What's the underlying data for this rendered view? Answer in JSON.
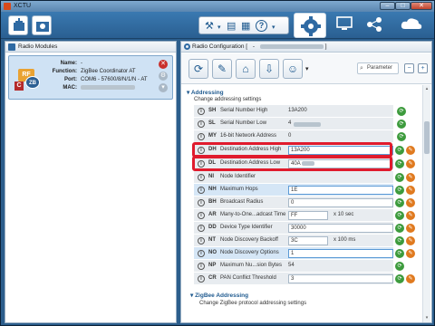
{
  "window": {
    "title": "XCTU"
  },
  "toolbar": {
    "icons": [
      "add-device-icon",
      "discover-icon",
      "tools-icon",
      "console-icon",
      "document-icon",
      "help-icon",
      "configuration-icon",
      "terminal-icon",
      "network-icon"
    ],
    "group_glyphs": {
      "tools": "⚒",
      "dropdown": "▾",
      "console": "▤",
      "doc": "▦",
      "help": "?"
    }
  },
  "left_panel": {
    "title": "Radio Modules",
    "device": {
      "name_label": "Name:",
      "name_value": "-",
      "function_label": "Function:",
      "function_value": "ZigBee Coordinator AT",
      "port_label": "Port:",
      "port_value": "COM6 - 57600/8/N/1/N - AT",
      "mac_label": "MAC:",
      "logo_rf": "RF",
      "logo_zb": "ZB",
      "logo_c": "C"
    }
  },
  "right_panel": {
    "title": "Radio Configuration [",
    "title_end": "]",
    "param_placeholder": "Parameter",
    "section": "Addressing",
    "section_sub": "Change addressing settings",
    "next_section": "ZigBee Addressing",
    "next_sub": "Change ZigBee protocol addressing settings",
    "rows": [
      {
        "code": "SH",
        "name": "Serial Number High",
        "value": "13A200"
      },
      {
        "code": "SL",
        "name": "Serial Number Low",
        "value": "4"
      },
      {
        "code": "MY",
        "name": "16-bit Network Address",
        "value": "0"
      },
      {
        "code": "DH",
        "name": "Destination Address High",
        "value": "13A200"
      },
      {
        "code": "DL",
        "name": "Destination Address Low",
        "value": "40A"
      },
      {
        "code": "NI",
        "name": "Node Identifier",
        "value": ""
      },
      {
        "code": "NH",
        "name": "Maximum Hops",
        "value": "1E"
      },
      {
        "code": "BH",
        "name": "Broadcast Radius",
        "value": "0"
      },
      {
        "code": "AR",
        "name": "Many-to-One...adcast Time",
        "value": "FF",
        "unit": "x 10 sec"
      },
      {
        "code": "DD",
        "name": "Device Type Identifier",
        "value": "30000"
      },
      {
        "code": "NT",
        "name": "Node Discovery Backoff",
        "value": "3C",
        "unit": "x 100 ms"
      },
      {
        "code": "NO",
        "name": "Node Discovery Options",
        "value": "1"
      },
      {
        "code": "NP",
        "name": "Maximum Nu...sion Bytes",
        "value": "54"
      },
      {
        "code": "CR",
        "name": "PAN Conflict Threshold",
        "value": "3"
      }
    ]
  },
  "colors": {
    "highlight_box": "#e01b2d",
    "accent": "#2c5e8c"
  }
}
